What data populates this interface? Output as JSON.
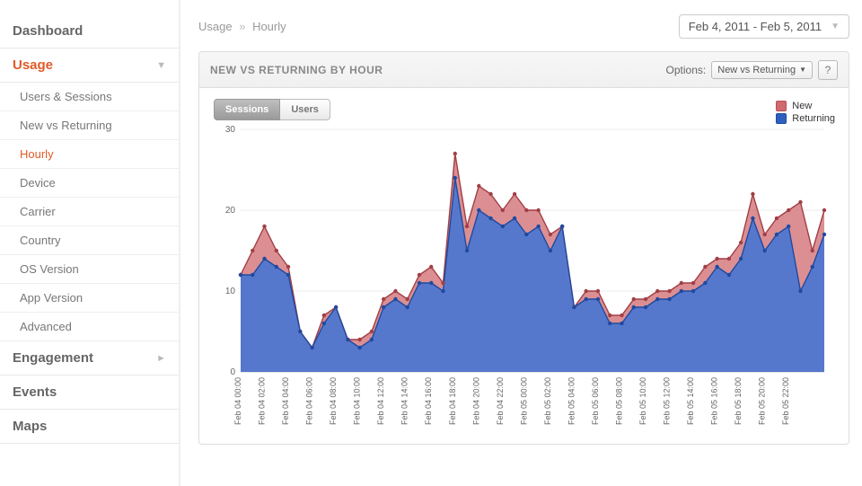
{
  "sidebar": {
    "top": [
      {
        "label": "Dashboard",
        "expandable": false
      },
      {
        "label": "Usage",
        "expandable": true,
        "active": true,
        "chev": "▼"
      },
      {
        "label": "Engagement",
        "expandable": true,
        "chev": "►"
      },
      {
        "label": "Events",
        "expandable": false
      },
      {
        "label": "Maps",
        "expandable": false
      }
    ],
    "usage_sub": [
      {
        "label": "Users & Sessions"
      },
      {
        "label": "New vs Returning"
      },
      {
        "label": "Hourly",
        "current": true
      },
      {
        "label": "Device"
      },
      {
        "label": "Carrier"
      },
      {
        "label": "Country"
      },
      {
        "label": "OS Version"
      },
      {
        "label": "App Version"
      },
      {
        "label": "Advanced"
      }
    ]
  },
  "breadcrumb": {
    "root": "Usage",
    "sep": "»",
    "leaf": "Hourly"
  },
  "date_range": "Feb 4, 2011 - Feb 5, 2011",
  "panel": {
    "title": "NEW VS RETURNING BY HOUR",
    "options_label": "Options:",
    "select_value": "New vs Returning",
    "help": "?"
  },
  "tabs": [
    {
      "label": "Sessions",
      "active": true
    },
    {
      "label": "Users",
      "active": false
    }
  ],
  "legend": {
    "new": "New",
    "returning": "Returning"
  },
  "chart_data": {
    "type": "area",
    "title": "NEW VS RETURNING BY HOUR",
    "xlabel": "",
    "ylabel": "",
    "ylim": [
      0,
      30
    ],
    "yticks": [
      0,
      10,
      20,
      30
    ],
    "categories": [
      "Feb 04 00:00",
      "Feb 04 02:00",
      "Feb 04 04:00",
      "Feb 04 06:00",
      "Feb 04 08:00",
      "Feb 04 10:00",
      "Feb 04 12:00",
      "Feb 04 14:00",
      "Feb 04 16:00",
      "Feb 04 18:00",
      "Feb 04 20:00",
      "Feb 04 22:00",
      "Feb 05 00:00",
      "Feb 05 02:00",
      "Feb 05 04:00",
      "Feb 05 06:00",
      "Feb 05 08:00",
      "Feb 05 10:00",
      "Feb 05 12:00",
      "Feb 05 14:00",
      "Feb 05 16:00",
      "Feb 05 18:00",
      "Feb 05 20:00",
      "Feb 05 22:00"
    ],
    "series": [
      {
        "name": "New",
        "color": "#cf6a6f",
        "values": [
          12,
          15,
          18,
          15,
          13,
          5,
          3,
          7,
          8,
          4,
          4,
          5,
          9,
          10,
          9,
          12,
          13,
          11,
          27,
          18,
          23,
          22,
          20,
          22,
          20,
          20,
          17,
          18,
          8,
          10,
          10,
          7,
          7,
          9,
          9,
          10,
          10,
          11,
          11,
          13,
          14,
          14,
          16,
          22,
          17,
          19,
          20,
          21,
          15,
          20
        ]
      },
      {
        "name": "Returning",
        "color": "#2e5fbf",
        "values": [
          12,
          12,
          14,
          13,
          12,
          5,
          3,
          6,
          8,
          4,
          3,
          4,
          8,
          9,
          8,
          11,
          11,
          10,
          24,
          15,
          20,
          19,
          18,
          19,
          17,
          18,
          15,
          18,
          8,
          9,
          9,
          6,
          6,
          8,
          8,
          9,
          9,
          10,
          10,
          11,
          13,
          12,
          14,
          19,
          15,
          17,
          18,
          10,
          13,
          17
        ]
      }
    ],
    "points_per_category": 2,
    "legend_position": "top-right"
  }
}
